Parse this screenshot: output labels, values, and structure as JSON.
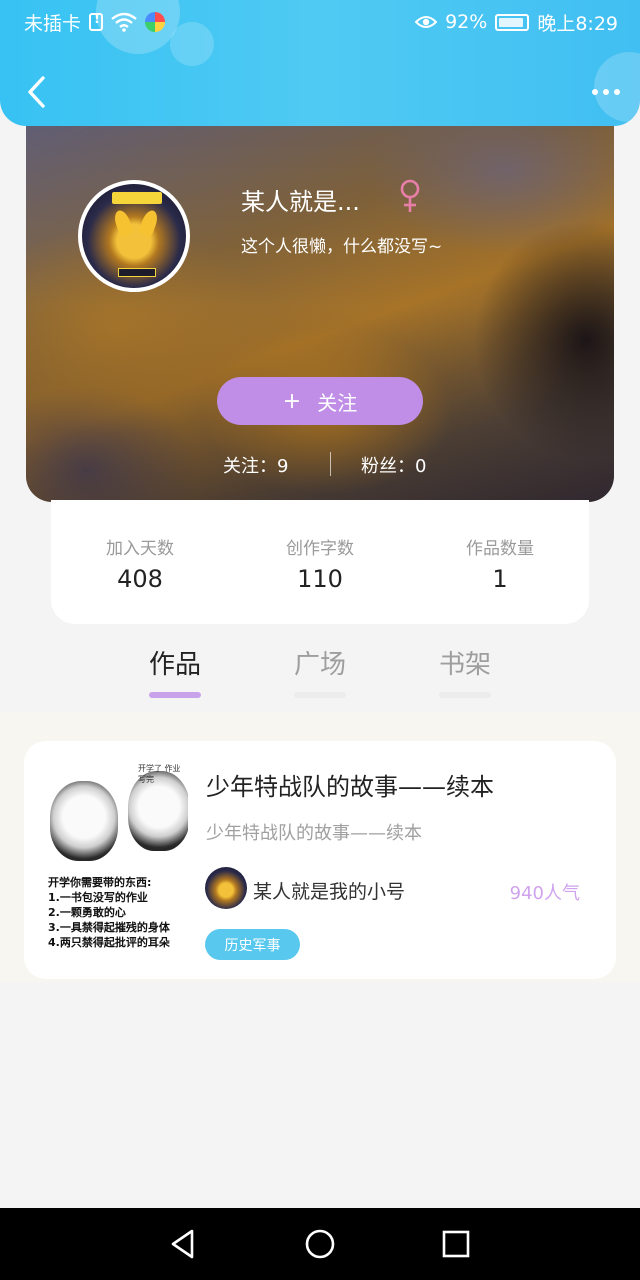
{
  "status_bar": {
    "carrier": "未插卡",
    "battery_percent": "92%",
    "time": "晚上8:29"
  },
  "profile": {
    "name": "某人就是...",
    "gender_symbol": "♀",
    "bio": "这个人很懒，什么都没写~",
    "follow_button": {
      "icon": "+",
      "label": "关注"
    },
    "following": "关注：9",
    "fans": "粉丝：0"
  },
  "stats": [
    {
      "label": "加入天数",
      "value": "408"
    },
    {
      "label": "创作字数",
      "value": "110"
    },
    {
      "label": "作品数量",
      "value": "1"
    }
  ],
  "tabs": [
    {
      "label": "作品",
      "active": true
    },
    {
      "label": "广场",
      "active": false
    },
    {
      "label": "书架",
      "active": false
    }
  ],
  "works": [
    {
      "title": "少年特战队的故事——续本",
      "subtitle": "少年特战队的故事——续本",
      "author": "某人就是我的小号",
      "popularity": "940人气",
      "category": "历史军事",
      "cover": {
        "small_text": "开学了 作业写完",
        "lines": [
          "开学你需要带的东西:",
          "1.一书包没写的作业",
          "2.一颗勇敢的心",
          "3.一具禁得起摧残的身体",
          "4.两只禁得起批评的耳朵"
        ]
      }
    }
  ],
  "colors": {
    "header_blue": "#41c3f3",
    "follow_purple": "#c08ee6",
    "tab_active_underline": "#c9a2ec",
    "popularity": "#d0a3ee",
    "tag_blue": "#58c8ee"
  },
  "icons": {
    "back": "chevron-left-icon",
    "more": "more-dots-icon",
    "gender": "female-icon",
    "sys_back": "triangle-back-icon",
    "sys_home": "circle-home-icon",
    "sys_recent": "square-recent-icon"
  }
}
